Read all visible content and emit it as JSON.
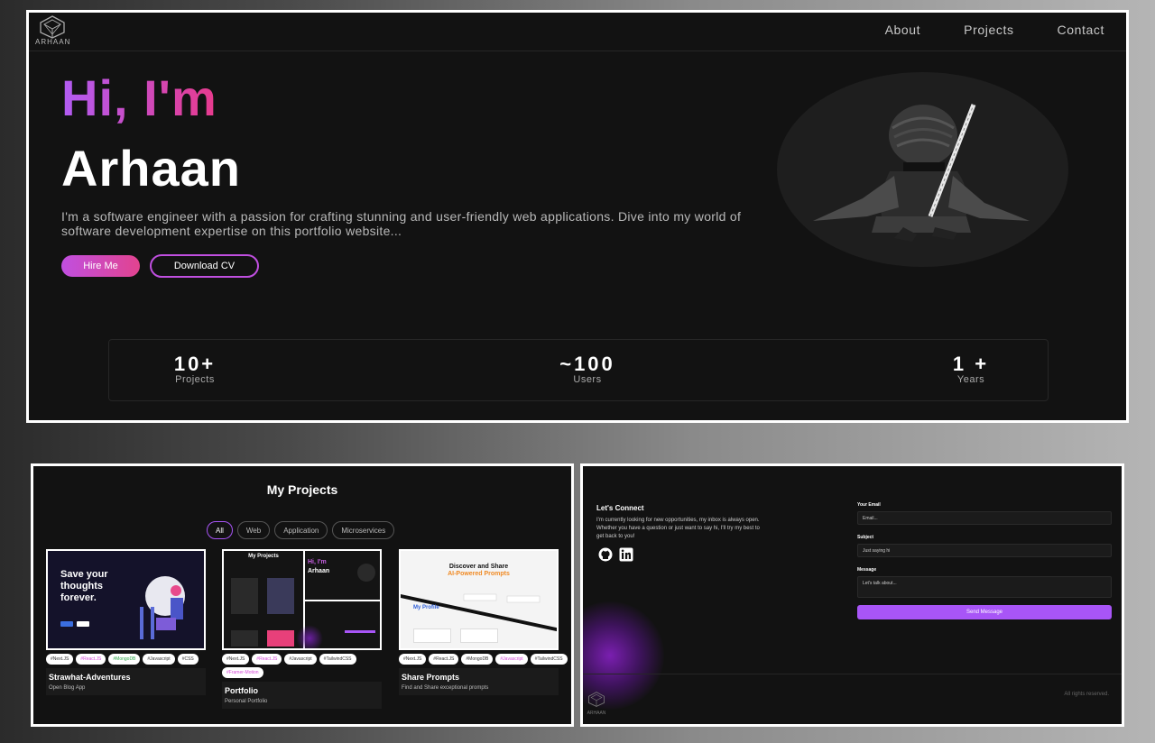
{
  "brand": {
    "logo_text": "ARHAAN"
  },
  "nav": {
    "items": [
      "About",
      "Projects",
      "Contact"
    ]
  },
  "hero": {
    "greeting": "Hi, I'm",
    "name": "Arhaan",
    "bio": "I'm a software engineer with a passion for crafting stunning and user-friendly web applications. Dive into my world of software development expertise on this portfolio website...",
    "hire_label": "Hire Me",
    "cv_label": "Download CV",
    "stats": [
      {
        "value": "10+",
        "label": "Projects"
      },
      {
        "value": "~100",
        "label": "Users"
      },
      {
        "value": "1 +",
        "label": "Years"
      }
    ]
  },
  "projects": {
    "title": "My Projects",
    "filters": [
      "All",
      "Web",
      "Application",
      "Microservices"
    ],
    "active_filter": "All",
    "cards": [
      {
        "title": "Strawhat-Adventures",
        "desc": "Open Blog App",
        "tags": [
          "#Next.JS",
          "#React.JS",
          "#MongoDB",
          "#Javascript",
          "#CSS"
        ],
        "thumb_text": "Save your thoughts forever."
      },
      {
        "title": "Portfolio",
        "desc": "Personal Portfolio",
        "tags": [
          "#Next.JS",
          "#React.JS",
          "#Javascript",
          "#TailwindCSS",
          "#Framer-Motion"
        ],
        "thumb_text": "My Projects",
        "thumb_hero_hi": "Hi, I'm",
        "thumb_hero_name": "Arhaan"
      },
      {
        "title": "Share Prompts",
        "desc": "Find and Share exceptional prompts",
        "tags": [
          "#Next.JS",
          "#React.JS",
          "#MongoDB",
          "#Javascript",
          "#TailwindCSS"
        ],
        "thumb_text": "Discover and Share",
        "thumb_sub": "AI-Powered Prompts",
        "thumb_profile": "My Profile"
      }
    ]
  },
  "contact": {
    "title": "Let's Connect",
    "text": "I'm currently looking for new opportunities, my inbox is always open. Whether you have a question or just want to say hi, I'll try my best to get back to you!",
    "email_label": "Your Email",
    "email_placeholder": "Email...",
    "subject_label": "Subject",
    "subject_placeholder": "Just saying hi",
    "message_label": "Message",
    "message_placeholder": "Let's talk about...",
    "send_label": "Send Message",
    "rights": "All rights reserved.",
    "social": [
      "github-icon",
      "linkedin-icon"
    ]
  },
  "colors": {
    "accent": "#a855f7",
    "pink": "#e2438f",
    "bg": "#121212"
  }
}
